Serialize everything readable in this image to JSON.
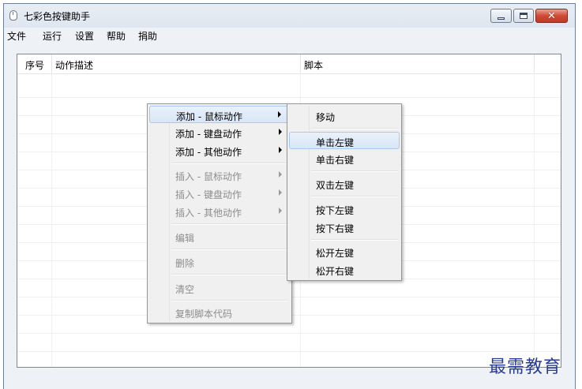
{
  "window": {
    "title": "七彩色按键助手"
  },
  "menubar": [
    "文件",
    "运行",
    "设置",
    "帮助",
    "捐助"
  ],
  "list": {
    "columns": [
      "序号",
      "动作描述",
      "脚本"
    ]
  },
  "context_menu": {
    "items": [
      {
        "label": "添加 - 鼠标动作",
        "submenu": true,
        "disabled": false,
        "highlighted": true
      },
      {
        "label": "添加 - 键盘动作",
        "submenu": true,
        "disabled": false
      },
      {
        "label": "添加 - 其他动作",
        "submenu": true,
        "disabled": false
      },
      {
        "label": "插入 - 鼠标动作",
        "submenu": true,
        "disabled": true
      },
      {
        "label": "插入 - 键盘动作",
        "submenu": true,
        "disabled": true
      },
      {
        "label": "插入 - 其他动作",
        "submenu": true,
        "disabled": true
      },
      {
        "label": "编辑",
        "disabled": true
      },
      {
        "label": "删除",
        "disabled": true
      },
      {
        "label": "清空",
        "disabled": true
      },
      {
        "label": "复制脚本代码",
        "disabled": true
      }
    ]
  },
  "submenu": {
    "items": [
      {
        "label": "移动"
      },
      {
        "label": "单击左键",
        "highlighted": true
      },
      {
        "label": "单击右键"
      },
      {
        "label": "双击左键"
      },
      {
        "label": "按下左键"
      },
      {
        "label": "按下右键"
      },
      {
        "label": "松开左键"
      },
      {
        "label": "松开右键"
      }
    ]
  },
  "watermark": "最需教育"
}
